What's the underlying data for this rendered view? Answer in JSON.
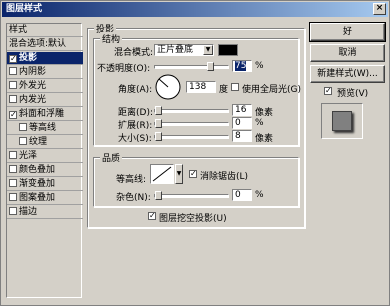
{
  "window": {
    "title": "图层样式"
  },
  "styles_list": [
    {
      "label": "样式",
      "checkbox": false,
      "checked": false,
      "selected": false,
      "bold": false
    },
    {
      "label": "混合选项:默认",
      "checkbox": false,
      "checked": false,
      "selected": false,
      "bold": false
    },
    {
      "label": "投影",
      "checkbox": true,
      "checked": true,
      "selected": true,
      "bold": true
    },
    {
      "label": "内阴影",
      "checkbox": true,
      "checked": false,
      "selected": false,
      "bold": false
    },
    {
      "label": "外发光",
      "checkbox": true,
      "checked": false,
      "selected": false,
      "bold": false
    },
    {
      "label": "内发光",
      "checkbox": true,
      "checked": false,
      "selected": false,
      "bold": false
    },
    {
      "label": "斜面和浮雕",
      "checkbox": true,
      "checked": true,
      "selected": false,
      "bold": false
    },
    {
      "label": "等高线",
      "checkbox": true,
      "checked": false,
      "selected": false,
      "bold": false
    },
    {
      "label": "纹理",
      "checkbox": true,
      "checked": false,
      "selected": false,
      "bold": false
    },
    {
      "label": "光泽",
      "checkbox": true,
      "checked": false,
      "selected": false,
      "bold": false
    },
    {
      "label": "颜色叠加",
      "checkbox": true,
      "checked": false,
      "selected": false,
      "bold": false
    },
    {
      "label": "渐变叠加",
      "checkbox": true,
      "checked": false,
      "selected": false,
      "bold": false
    },
    {
      "label": "图案叠加",
      "checkbox": true,
      "checked": false,
      "selected": false,
      "bold": false
    },
    {
      "label": "描边",
      "checkbox": true,
      "checked": false,
      "selected": false,
      "bold": false
    }
  ],
  "drop_shadow": {
    "group_title": "投影",
    "structure_title": "结构",
    "blend_mode_label": "混合模式:",
    "blend_mode_value": "正片叠底",
    "blend_color": "#000000",
    "opacity_label": "不透明度(O):",
    "opacity_value": "75",
    "opacity_unit": "%",
    "angle_label": "角度(A):",
    "angle_value": "138",
    "angle_unit": "度",
    "global_light_label": "使用全局光(G)",
    "global_light_checked": false,
    "distance_label": "距离(D):",
    "distance_value": "16",
    "distance_unit": "像素",
    "spread_label": "扩展(R):",
    "spread_value": "0",
    "spread_unit": "%",
    "size_label": "大小(S):",
    "size_value": "8",
    "size_unit": "像素",
    "quality_title": "品质",
    "contour_label": "等高线:",
    "antialias_label": "消除锯齿(L)",
    "antialias_checked": true,
    "noise_label": "杂色(N):",
    "noise_value": "0",
    "noise_unit": "%",
    "knockout_label": "图层挖空投影(U)",
    "knockout_checked": true
  },
  "buttons": {
    "ok": "好",
    "cancel": "取消",
    "new_style": "新建样式(W)...",
    "preview_label": "预览(V)",
    "preview_checked": true
  }
}
